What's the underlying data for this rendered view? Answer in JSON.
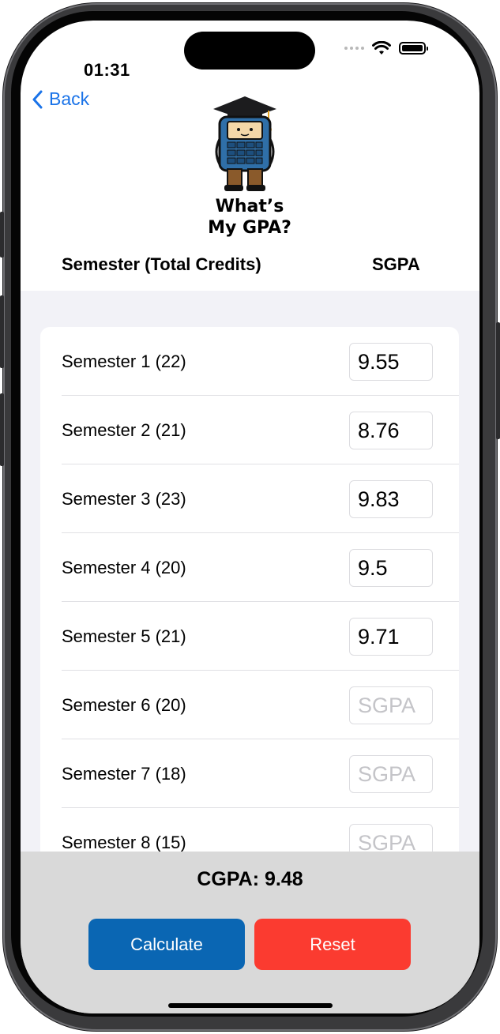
{
  "status_bar": {
    "time": "01:31"
  },
  "nav": {
    "back_label": "Back"
  },
  "app": {
    "title_line1": "What’s",
    "title_line2": "My GPA?"
  },
  "table_header": {
    "semester_col": "Semester (Total Credits)",
    "sgpa_col": "SGPA"
  },
  "semesters": [
    {
      "label": "Semester 1 (22)",
      "value": "9.55",
      "placeholder": "SGPA"
    },
    {
      "label": "Semester 2 (21)",
      "value": "8.76",
      "placeholder": "SGPA"
    },
    {
      "label": "Semester 3 (23)",
      "value": "9.83",
      "placeholder": "SGPA"
    },
    {
      "label": "Semester 4 (20)",
      "value": "9.5",
      "placeholder": "SGPA"
    },
    {
      "label": "Semester 5 (21)",
      "value": "9.71",
      "placeholder": "SGPA"
    },
    {
      "label": "Semester 6 (20)",
      "value": "",
      "placeholder": "SGPA"
    },
    {
      "label": "Semester 7 (18)",
      "value": "",
      "placeholder": "SGPA"
    },
    {
      "label": "Semester 8 (15)",
      "value": "",
      "placeholder": "SGPA"
    }
  ],
  "result": {
    "cgpa_text": "CGPA: 9.48"
  },
  "actions": {
    "calculate_label": "Calculate",
    "reset_label": "Reset"
  },
  "colors": {
    "accent_blue": "#0a66b3",
    "reset_red": "#fb3b30",
    "link_blue": "#1a73e8"
  },
  "icons": {
    "back": "chevron-left-icon",
    "wifi": "wifi-icon",
    "battery": "battery-icon",
    "signal": "signal-dots-icon",
    "logo": "calculator-graduate-logo"
  }
}
